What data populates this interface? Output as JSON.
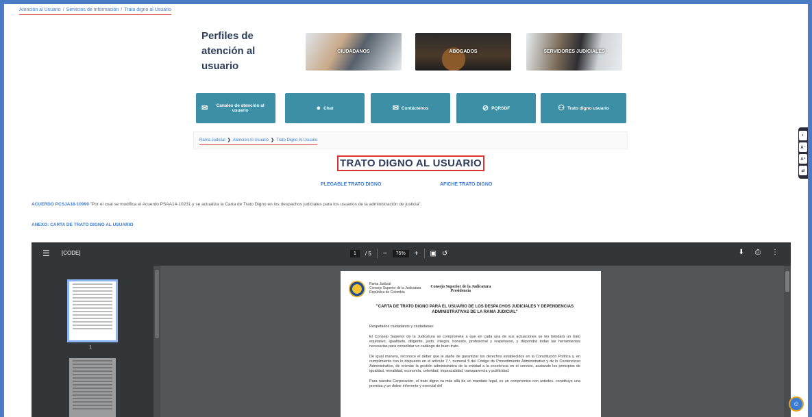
{
  "top_breadcrumb": {
    "items": [
      "Atención al Usuario",
      "Servicios de Información",
      "Trato digno al Usuario"
    ],
    "separator": "/"
  },
  "profiles": {
    "title": "Perfiles de atención al usuario",
    "cards": [
      "CIUDADANOS",
      "ABOGADOS",
      "SERVIDORES JUDICIALES"
    ]
  },
  "actions": [
    {
      "label": "Canales de atención al usuario",
      "icon": "mail-icon"
    },
    {
      "label": "Chat",
      "icon": "chat-icon"
    },
    {
      "label": "Contáctenos",
      "icon": "envelope-icon"
    },
    {
      "label": "PQRSDF",
      "icon": "paperclip-icon"
    },
    {
      "label": "Trato digno usuario",
      "icon": "people-icon"
    }
  ],
  "inner_breadcrumb": {
    "items": [
      "Rama Judicial",
      "Atención Al Usuario",
      "Trato Digno Al Usuario"
    ]
  },
  "main_title": "TRATO DIGNO AL USUARIO",
  "doc_links": [
    "PLEGABLE TRATO DIGNO",
    "AFICHE TRATO DIGNO"
  ],
  "acuerdo": {
    "code": "ACUERDO PCSJA18-10999",
    "text": " \"Por el cual se modifica el Acuerdo PSAA14-10231 y se actualiza la Carta de Trato Digno en los despachos judiciales para los usuarios de la administración de justicia\"."
  },
  "anexo": "ANEXO: CARTA DE TRATO DIGNO AL USUARIO",
  "side_tools": [
    "◐",
    "A⁻",
    "A⁺",
    "⇄"
  ],
  "viewer": {
    "title": "[CODE]",
    "page_current": "1",
    "page_total": "/ 5",
    "zoom": "75%",
    "thumb_page_number": "1",
    "page": {
      "header_left": [
        "Rama Judicial",
        "Consejo Superior de la Judicatura",
        "República de Colombia"
      ],
      "header_right": [
        "Consejo Superior de la Judicatura",
        "Presidencia"
      ],
      "title": "\"CARTA DE TRATO DIGNO PARA EL USUARIO DE LOS DESPACHOS JUDICIALES Y DEPENDENCIAS ADMINISTRATIVAS DE LA RAMA JUDICIAL\"",
      "paragraphs": [
        "Respetados ciudadanos y ciudadanas:",
        "El Consejo Superior de la Judicatura se compromete a que en cada una de sus actuaciones se les brindará un trato equitativo, igualitario, diligente, justo, íntegro, honesto, profesional y respetuoso, y dispondrá todas las herramientas necesarias para consolidar un catálogo de buen trato.",
        "De igual manera, reconoce el deber que le atañe de garantizar los derechos establecidos en la Constitución Política y, en cumplimiento con lo dispuesto en el artículo 7.°, numeral 5 del Código de Procedimiento Administrativo y de lo Contencioso Administrativo, de orientar la gestión administrativa de la entidad a la excelencia en el servicio, acatando los principios de igualdad, moralidad, economía, celeridad, imparcialidad, transparencia y publicidad.",
        "Para nuestra Corporación, el trato digno va más allá de un mandato legal, es un compromiso con ustedes, constituye una premisa y un deber inherente y esencial del"
      ]
    }
  },
  "colors": {
    "accent_blue": "#3a7bd5",
    "action_teal": "#3d8fa6",
    "highlight_red": "#dd3333",
    "title_navy": "#2c3e5a"
  }
}
